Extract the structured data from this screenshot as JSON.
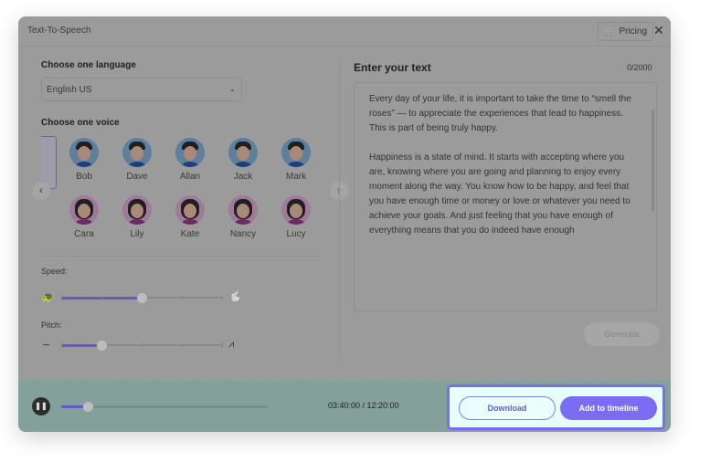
{
  "header": {
    "title": "Text-To-Speech",
    "pricing_label": "Pricing",
    "close": "✕"
  },
  "language": {
    "heading": "Choose one language",
    "selected": "English US"
  },
  "voice": {
    "heading": "Choose one voice",
    "male": [
      "Bob",
      "Dave",
      "Allan",
      "Jack",
      "Mark"
    ],
    "female": [
      "Cara",
      "Lily",
      "Kate",
      "Nancy",
      "Lucy"
    ]
  },
  "speed": {
    "label": "Speed:",
    "value_fraction": 0.5,
    "steps": 5
  },
  "pitch": {
    "label": "Pitch:",
    "value_fraction": 0.25,
    "steps": 5
  },
  "text": {
    "heading": "Enter your text",
    "count": "0/2000",
    "paragraphs": [
      "Every day of your life, it is important to take the time to “smell the roses” — to appreciate the experiences that lead to happiness. This is part of being truly happy.",
      "Happiness is a state of mind. It starts with accepting where you are, knowing where you are going and planning to enjoy every moment along the way. You know how to be happy, and feel that you have enough time or money or love or whatever you need to achieve your goals. And just feeling that you have enough of everything means that you do indeed have enough"
    ]
  },
  "generate_label": "Generate",
  "player": {
    "time": "03:40:00 / 12:20:00",
    "progress_fraction": 0.13
  },
  "actions": {
    "download": "Download",
    "add_to_timeline": "Add to timeline"
  },
  "colors": {
    "accent": "#7b6cf5",
    "highlight_bg": "#e6fffd"
  }
}
